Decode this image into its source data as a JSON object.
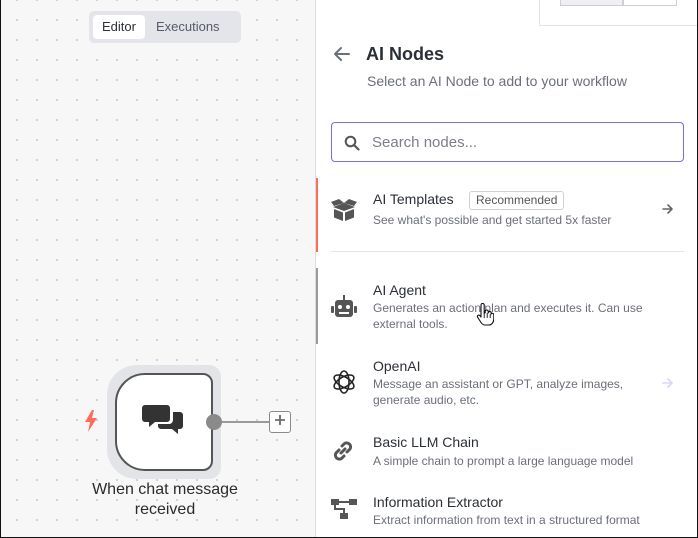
{
  "tabs": [
    {
      "label": "Editor",
      "active": true
    },
    {
      "label": "Executions",
      "active": false
    }
  ],
  "canvas": {
    "trigger_node": {
      "label": "When chat message received",
      "icon": "chat-bubbles-icon",
      "trigger_icon": "lightning-bolt-icon"
    },
    "add_node_icon": "plus-icon"
  },
  "panel": {
    "title": "AI Nodes",
    "subtitle": "Select an AI Node to add to your workflow",
    "search": {
      "placeholder": "Search nodes...",
      "value": ""
    },
    "templates": {
      "name": "AI Templates",
      "badge": "Recommended",
      "description": "See what's possible and get started 5x faster",
      "icon": "open-box-icon"
    },
    "items": [
      {
        "name": "AI Agent",
        "description": "Generates an action plan and executes it. Can use external tools.",
        "icon": "robot-icon"
      },
      {
        "name": "OpenAI",
        "description": "Message an assistant or GPT, analyze images, generate audio, etc.",
        "icon": "openai-icon"
      },
      {
        "name": "Basic LLM Chain",
        "description": "A simple chain to prompt a large language model",
        "icon": "link-icon"
      },
      {
        "name": "Information Extractor",
        "description": "Extract information from text in a structured format",
        "icon": "hierarchy-icon"
      }
    ]
  },
  "colors": {
    "accent": "#ff6d5a",
    "search_border": "#7b6fd1",
    "trigger_bolt": "#ff6d5a"
  }
}
